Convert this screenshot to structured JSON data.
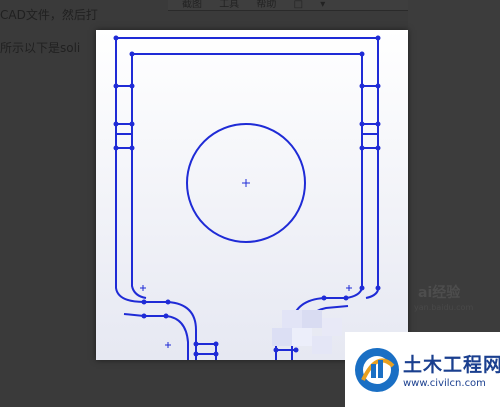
{
  "background": {
    "line1": "CAD文件，然后打",
    "line2": "所示以下是soli",
    "toolbar_items": [
      "截图",
      "工具",
      "帮助",
      "□",
      "▾"
    ],
    "watermark": "ai经验",
    "watermark_url": "yan.baidu.com"
  },
  "logo": {
    "name": "土木工程网",
    "url": "www.civilcn.com"
  },
  "colors": {
    "sketch_line": "#1f2bd6",
    "viewer_bg": "#ffffff",
    "logo_text": "#1a3f8f"
  }
}
